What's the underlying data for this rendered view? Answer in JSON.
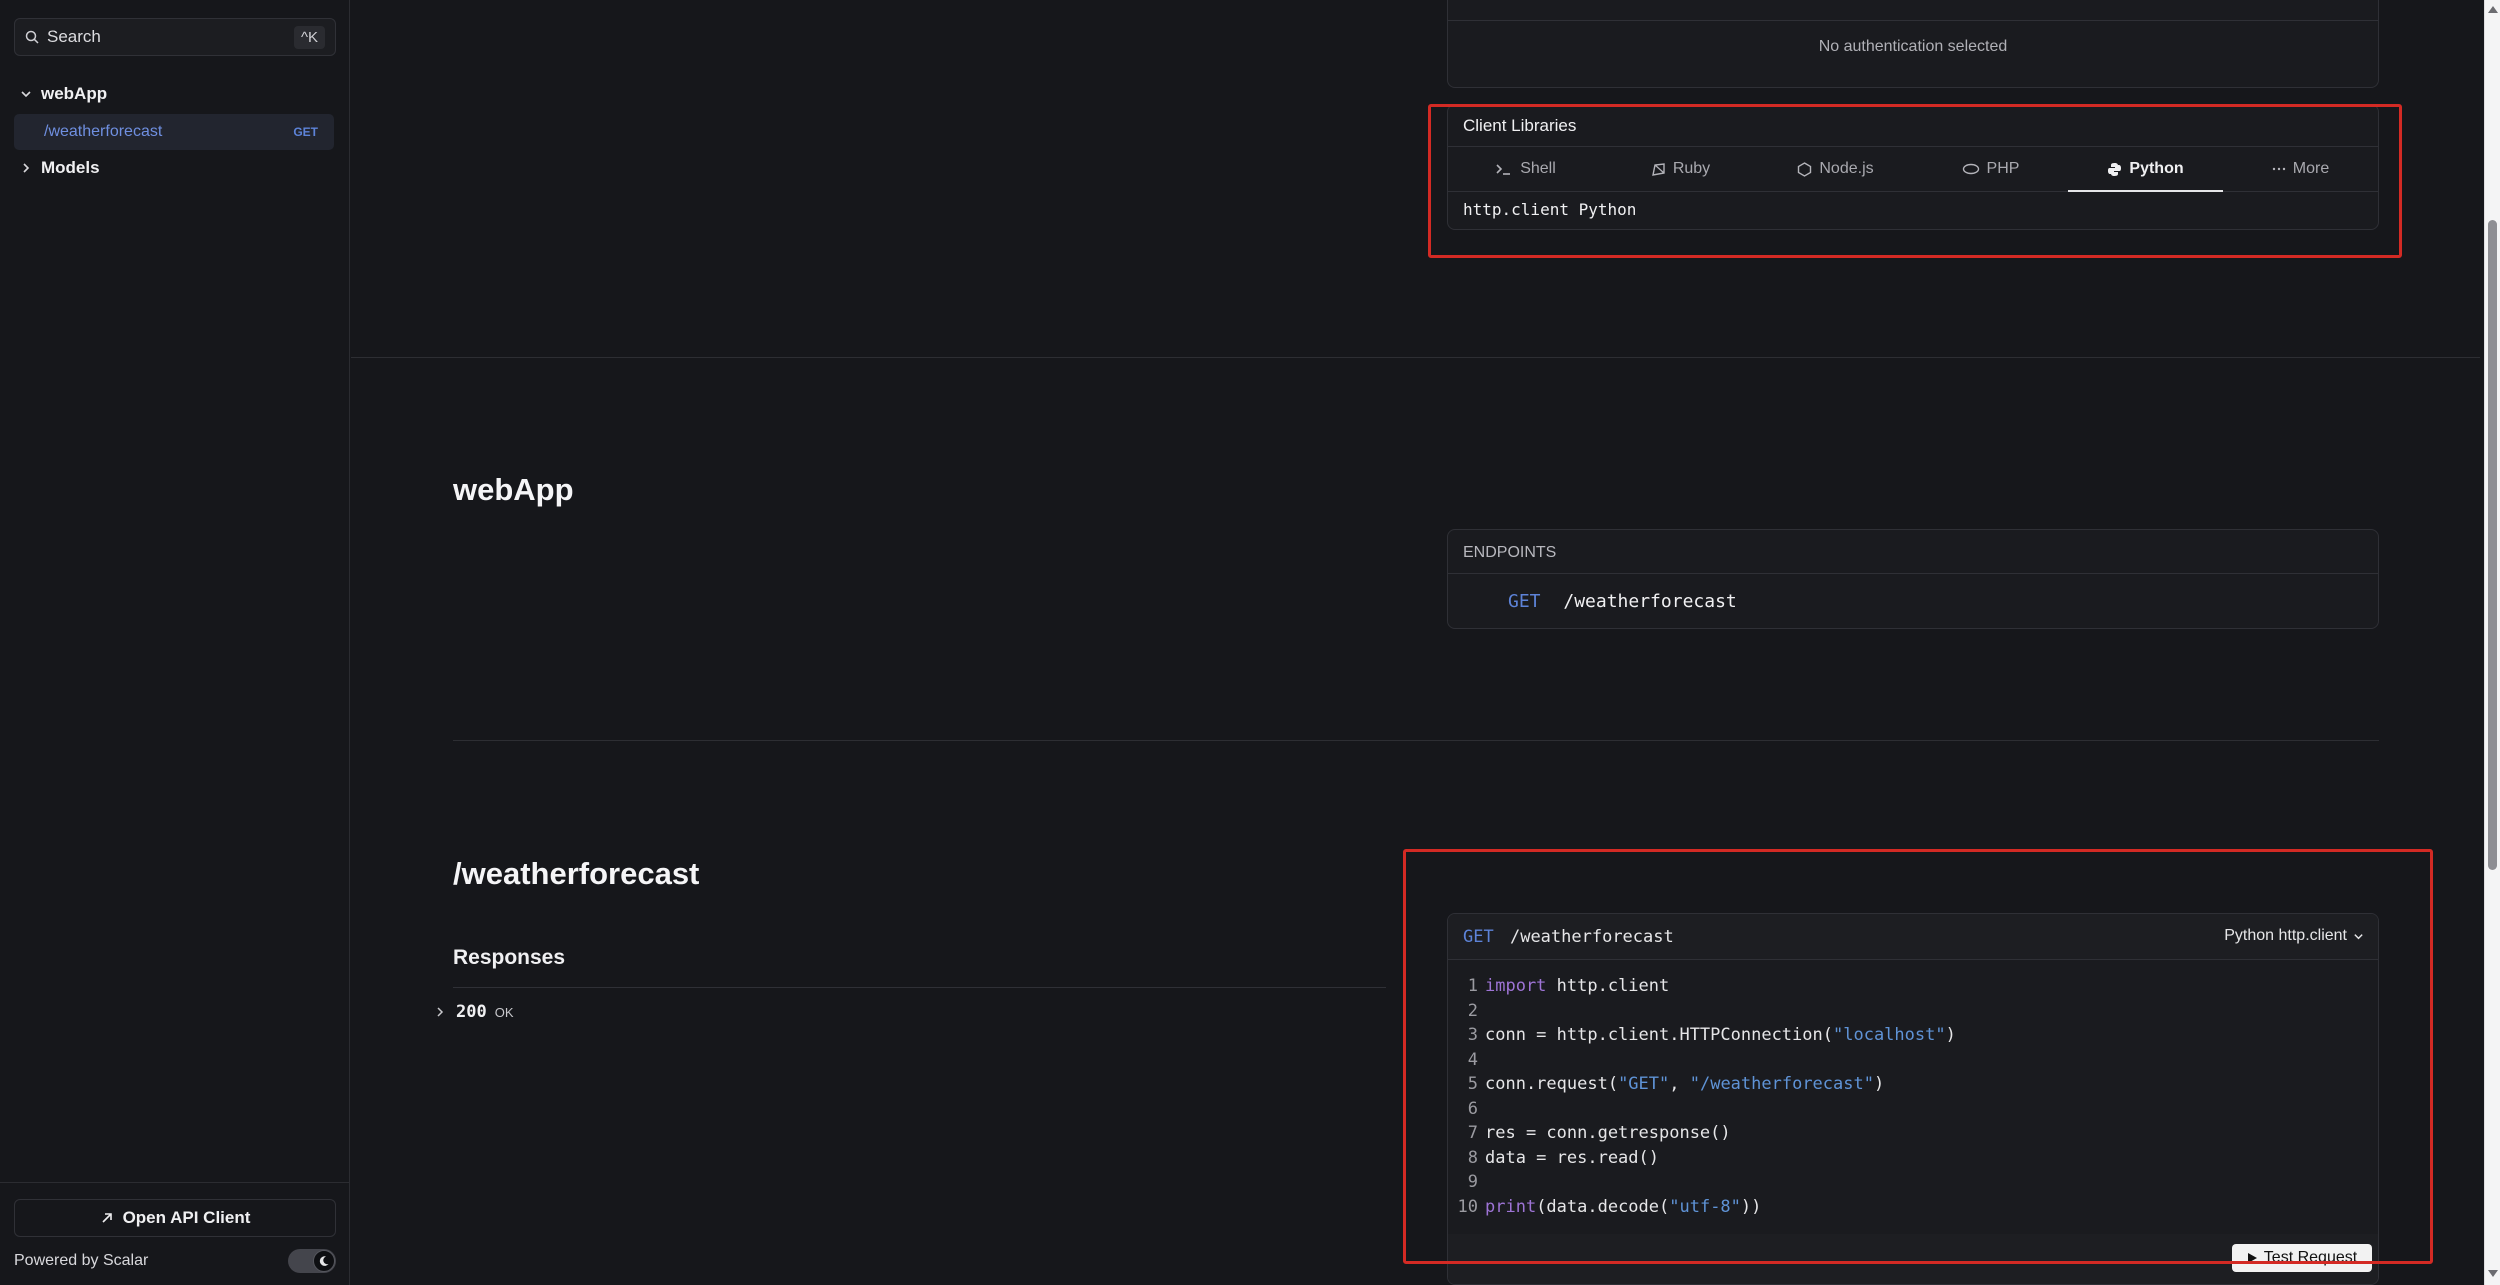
{
  "sidebar": {
    "search_label": "Search",
    "search_shortcut": "^K",
    "groups": [
      {
        "label": "webApp",
        "expanded": true
      },
      {
        "label": "Models",
        "expanded": false
      }
    ],
    "items": [
      {
        "label": "/weatherforecast",
        "method": "GET",
        "active": true
      }
    ],
    "open_client_label": "Open API Client",
    "powered_by": "Powered by Scalar"
  },
  "auth": {
    "empty_text": "No authentication selected"
  },
  "client_libraries": {
    "title": "Client Libraries",
    "tabs": [
      {
        "label": "Shell",
        "icon": "terminal-icon"
      },
      {
        "label": "Ruby",
        "icon": "ruby-icon"
      },
      {
        "label": "Node.js",
        "icon": "nodejs-icon"
      },
      {
        "label": "PHP",
        "icon": "php-icon"
      },
      {
        "label": "Python",
        "icon": "python-icon",
        "active": true
      },
      {
        "label": "More",
        "icon": "ellipsis-icon"
      }
    ],
    "selected_client": "http.client Python"
  },
  "section": {
    "title": "webApp",
    "endpoints_header": "ENDPOINTS",
    "endpoints": [
      {
        "method": "GET",
        "path": "/weatherforecast"
      }
    ]
  },
  "endpoint": {
    "title": "/weatherforecast",
    "responses_title": "Responses",
    "responses": [
      {
        "code": "200",
        "text": "OK"
      }
    ]
  },
  "code_example": {
    "method": "GET",
    "path": "/weatherforecast",
    "language_label": "Python http.client",
    "lines": [
      {
        "n": "1",
        "t": "import http.client"
      },
      {
        "n": "2",
        "t": ""
      },
      {
        "n": "3",
        "t": "conn = http.client.HTTPConnection(\"localhost\")"
      },
      {
        "n": "4",
        "t": ""
      },
      {
        "n": "5",
        "t": "conn.request(\"GET\", \"/weatherforecast\")"
      },
      {
        "n": "6",
        "t": ""
      },
      {
        "n": "7",
        "t": "res = conn.getresponse()"
      },
      {
        "n": "8",
        "t": "data = res.read()"
      },
      {
        "n": "9",
        "t": ""
      },
      {
        "n": "10",
        "t": "print(data.decode(\"utf-8\"))"
      }
    ],
    "test_button_label": "Test Request"
  },
  "colors": {
    "background": "#16171b",
    "accent_get": "#5d83d8",
    "highlight": "#d32a24",
    "keyword": "#9e74d6",
    "string": "#5f93d6"
  }
}
